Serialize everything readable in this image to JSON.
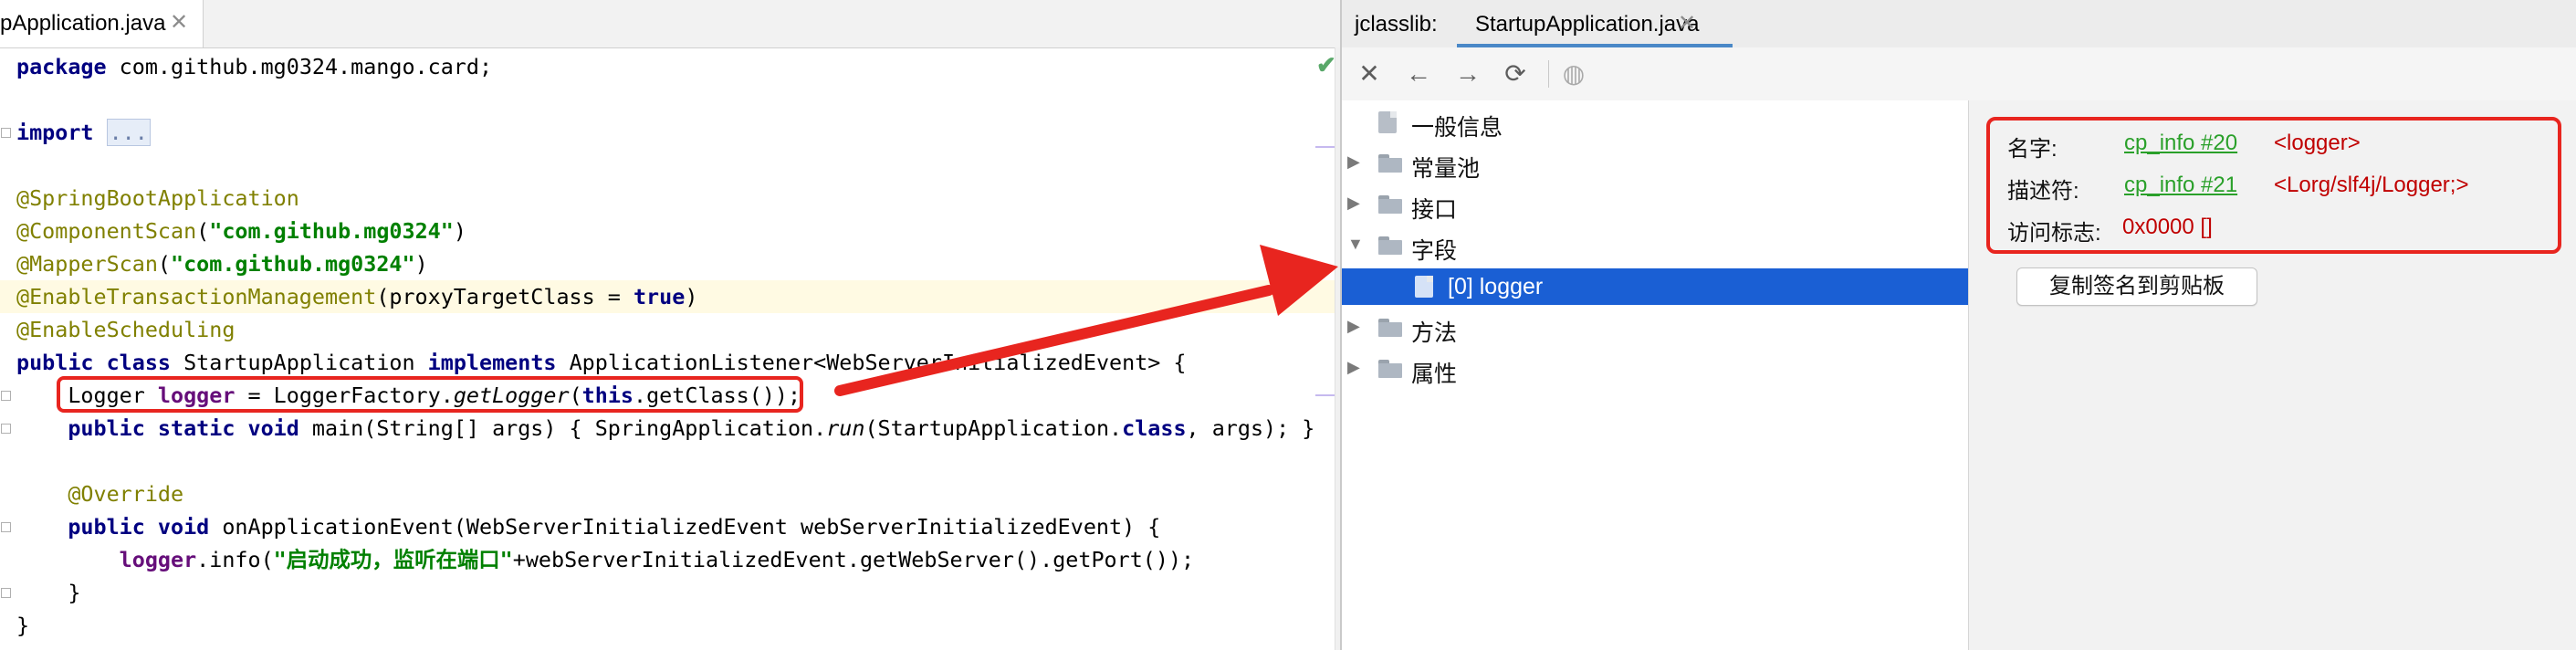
{
  "editor": {
    "tab_label": "pApplication.java",
    "tab_close": "✕",
    "check_icon": "✔",
    "lines": [
      {
        "segments": [
          {
            "t": "package",
            "c": "kw"
          },
          {
            "t": " com.github.mg0324.mango.card;",
            "c": ""
          }
        ]
      },
      {
        "segments": []
      },
      {
        "segments": [
          {
            "t": "import",
            "c": "kw"
          },
          {
            "t": " ",
            "c": ""
          },
          {
            "t": "...",
            "c": "fold-box"
          }
        ]
      },
      {
        "segments": []
      },
      {
        "segments": [
          {
            "t": "@SpringBootApplication",
            "c": "ann"
          }
        ]
      },
      {
        "segments": [
          {
            "t": "@ComponentScan",
            "c": "ann"
          },
          {
            "t": "(",
            "c": ""
          },
          {
            "t": "\"com.github.mg0324\"",
            "c": "str"
          },
          {
            "t": ")",
            "c": ""
          }
        ]
      },
      {
        "segments": [
          {
            "t": "@MapperScan",
            "c": "ann"
          },
          {
            "t": "(",
            "c": ""
          },
          {
            "t": "\"com.github.mg0324\"",
            "c": "str"
          },
          {
            "t": ")",
            "c": ""
          }
        ]
      },
      {
        "highlight": true,
        "segments": [
          {
            "t": "@EnableTransactionManagement",
            "c": "ann"
          },
          {
            "t": "(proxyTargetClass = ",
            "c": ""
          },
          {
            "t": "true",
            "c": "kw"
          },
          {
            "t": ")",
            "c": ""
          }
        ]
      },
      {
        "segments": [
          {
            "t": "@EnableScheduling",
            "c": "ann"
          }
        ]
      },
      {
        "segments": [
          {
            "t": "public class",
            "c": "kw"
          },
          {
            "t": " StartupApplication ",
            "c": ""
          },
          {
            "t": "implements",
            "c": "kw"
          },
          {
            "t": " ApplicationListener<WebServerInitializedEvent> {",
            "c": ""
          }
        ]
      },
      {
        "segments": [
          {
            "t": "    Logger ",
            "c": ""
          },
          {
            "t": "logger",
            "c": "fld"
          },
          {
            "t": " = LoggerFactory.",
            "c": ""
          },
          {
            "t": "getLogger",
            "c": "itl"
          },
          {
            "t": "(",
            "c": ""
          },
          {
            "t": "this",
            "c": "kw"
          },
          {
            "t": ".getClass());",
            "c": ""
          }
        ]
      },
      {
        "segments": [
          {
            "t": "    ",
            "c": ""
          },
          {
            "t": "public static void",
            "c": "kw"
          },
          {
            "t": " main(String[] args) { SpringApplication.",
            "c": ""
          },
          {
            "t": "run",
            "c": "itl"
          },
          {
            "t": "(StartupApplication.",
            "c": ""
          },
          {
            "t": "class",
            "c": "kw"
          },
          {
            "t": ", args); }",
            "c": ""
          }
        ]
      },
      {
        "segments": []
      },
      {
        "segments": [
          {
            "t": "    @Override",
            "c": "ann"
          }
        ]
      },
      {
        "segments": [
          {
            "t": "    ",
            "c": ""
          },
          {
            "t": "public void",
            "c": "kw"
          },
          {
            "t": " onApplicationEvent(WebServerInitializedEvent webServerInitializedEvent) {",
            "c": ""
          }
        ]
      },
      {
        "segments": [
          {
            "t": "        ",
            "c": ""
          },
          {
            "t": "logger",
            "c": "fld"
          },
          {
            "t": ".info(",
            "c": ""
          },
          {
            "t": "\"启动成功，监听在端口\"",
            "c": "str"
          },
          {
            "t": "+webServerInitializedEvent.getWebServer().getPort());",
            "c": ""
          }
        ]
      },
      {
        "segments": [
          {
            "t": "    }",
            "c": ""
          }
        ]
      },
      {
        "segments": [
          {
            "t": "}",
            "c": ""
          }
        ]
      }
    ]
  },
  "jclasslib": {
    "tool_label": "jclasslib:",
    "tab_label": "StartupApplication.java",
    "tab_close": "✕",
    "toolbar": {
      "close_icon": "✕",
      "back_icon": "←",
      "forward_icon": "→",
      "refresh_icon": "⟳",
      "web_icon": "◍"
    },
    "tree": [
      {
        "label": "一般信息",
        "icon": "file",
        "arrow": "",
        "indent": 0,
        "selected": false
      },
      {
        "label": "常量池",
        "icon": "folder",
        "arrow": "▶",
        "indent": 0,
        "selected": false
      },
      {
        "label": "接口",
        "icon": "folder",
        "arrow": "▶",
        "indent": 0,
        "selected": false
      },
      {
        "label": "字段",
        "icon": "folder",
        "arrow": "▼",
        "indent": 0,
        "selected": false
      },
      {
        "label": "[0] logger",
        "icon": "file",
        "arrow": "",
        "indent": 1,
        "selected": true
      },
      {
        "label": "方法",
        "icon": "folder",
        "arrow": "▶",
        "indent": 0,
        "selected": false
      },
      {
        "label": "属性",
        "icon": "folder",
        "arrow": "▶",
        "indent": 0,
        "selected": false
      }
    ],
    "detail": {
      "name_key": "名字:",
      "name_link": "cp_info #20",
      "name_value": "<logger>",
      "desc_key": "描述符:",
      "desc_link": "cp_info #21",
      "desc_value": "<Lorg/slf4j/Logger;>",
      "access_key": "访问标志:",
      "access_value": "0x0000 []",
      "copy_button": "复制签名到剪贴板"
    }
  },
  "colors": {
    "annotation_red": "#e8251f",
    "selection_blue": "#1a5fd4",
    "link_green": "#2aa02a",
    "value_red": "#c00000",
    "keyword_navy": "#000080",
    "annotation_olive": "#808000",
    "string_green": "#008000",
    "field_purple": "#660e7a"
  }
}
